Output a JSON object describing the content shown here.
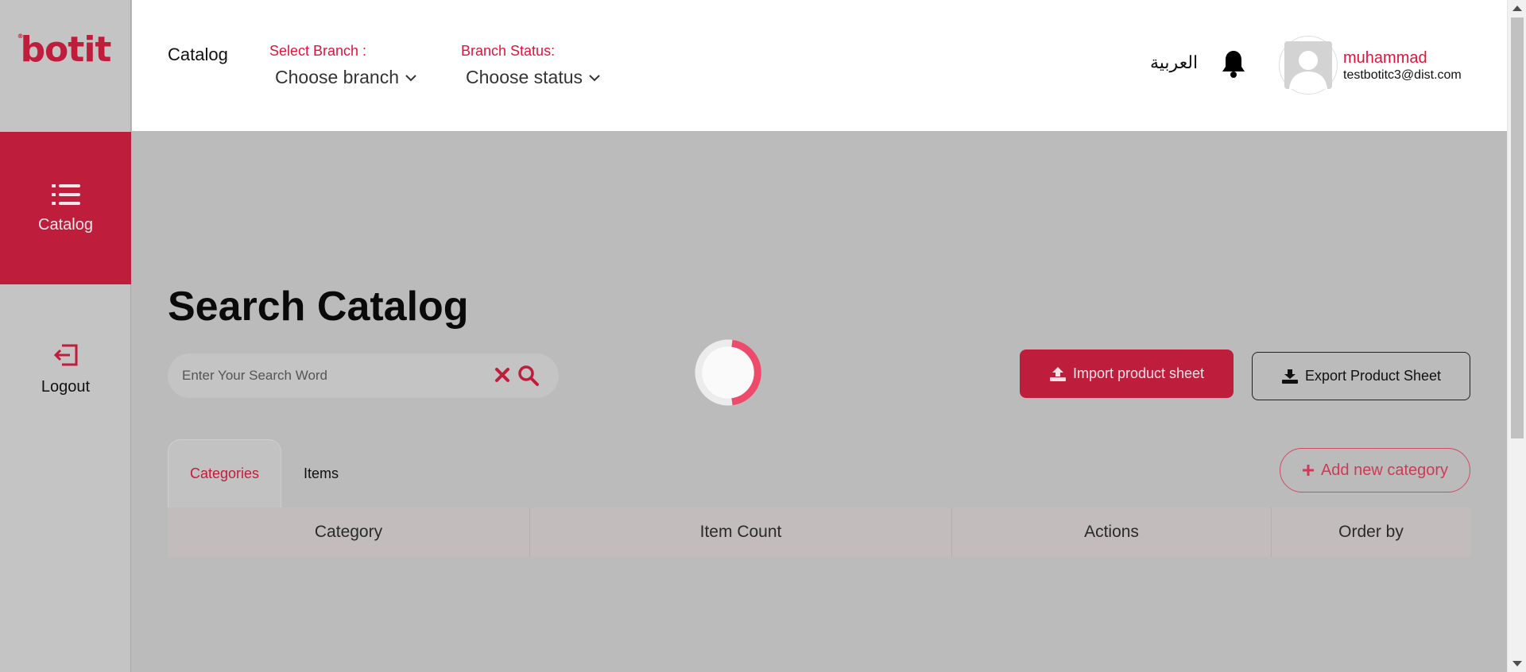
{
  "brand": {
    "logo_text": "botit",
    "accent": "#be1e3c"
  },
  "sidebar": {
    "items": [
      {
        "label": "Catalog",
        "icon": "list-icon",
        "active": true
      },
      {
        "label": "Logout",
        "icon": "logout-icon",
        "active": false
      }
    ]
  },
  "header": {
    "title": "Catalog",
    "branch": {
      "label": "Select Branch :",
      "value": "Choose branch"
    },
    "status": {
      "label": "Branch Status:",
      "value": "Choose status"
    },
    "language": "العربية",
    "user": {
      "name": "muhammad",
      "email": "testbotitc3@dist.com"
    }
  },
  "main": {
    "title": "Search Catalog",
    "search": {
      "placeholder": "Enter Your Search Word",
      "value": ""
    },
    "import_label": "Import product sheet",
    "export_label": "Export Product Sheet",
    "tabs": [
      {
        "label": "Categories",
        "active": true
      },
      {
        "label": "Items",
        "active": false
      }
    ],
    "add_category_label": "Add new category",
    "table": {
      "columns": [
        "Category",
        "Item Count",
        "Actions",
        "Order by"
      ],
      "rows": []
    }
  }
}
